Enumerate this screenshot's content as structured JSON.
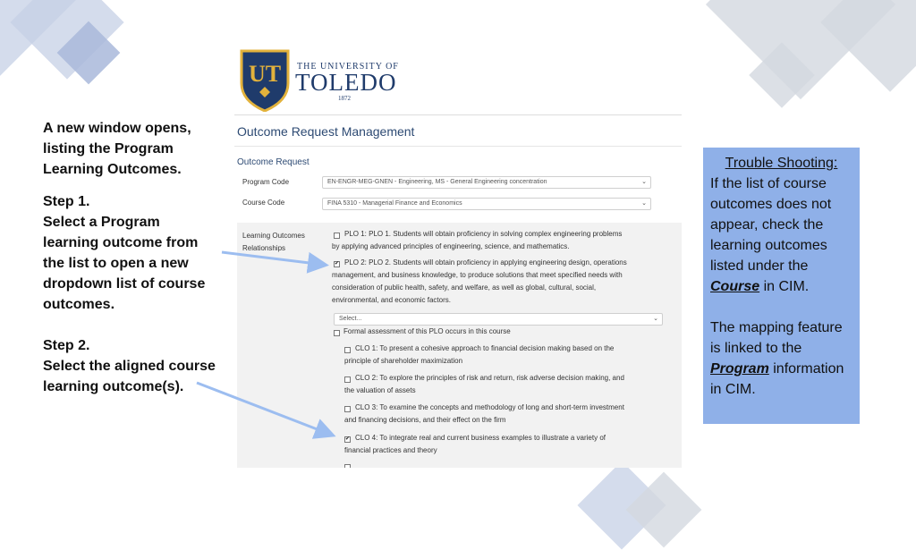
{
  "left": {
    "intro": [
      "A new window opens,",
      "listing the Program",
      "Learning Outcomes."
    ],
    "step1_title": "Step 1.",
    "step1_lines": [
      "Select a Program",
      "learning outcome from",
      "the list to open a new",
      "dropdown list of course",
      "outcomes."
    ],
    "step2_title": "Step 2.",
    "step2_lines": [
      "Select the aligned course",
      "learning outcome(s)."
    ]
  },
  "logo": {
    "monogram": "UT",
    "line1": "THE UNIVERSITY OF",
    "line2": "TOLEDO",
    "year": "1872"
  },
  "panel": {
    "title": "Outcome Request Management",
    "section": "Outcome Request",
    "program_code_label": "Program Code",
    "program_code_value": "EN-ENGR-MEG-GNEN - Engineering, MS - General Engineering concentration",
    "course_code_label": "Course Code",
    "course_code_value": "FINA 5310 - Managerial Finance and Economics",
    "lo_label_1": "Learning Outcomes",
    "lo_label_2": "Relationships",
    "plo1": [
      "PLO 1: PLO 1. Students will obtain proficiency in solving complex engineering problems",
      "by applying advanced principles of engineering, science, and mathematics."
    ],
    "plo2": [
      "PLO 2: PLO 2. Students will obtain proficiency in applying engineering design, operations",
      "management, and business knowledge, to produce solutions that meet specified needs with",
      "consideration of public health, safety, and welfare, as well as global, cultural, social,",
      "environmental, and economic factors."
    ],
    "select_placeholder": "Select...",
    "formal_assessment": "Formal assessment of this PLO occurs in this course",
    "clo1": [
      "CLO 1: To present a cohesive approach to financial decision making based on the",
      "principle of shareholder maximization"
    ],
    "clo2": [
      "CLO 2: To explore the principles of risk and return, risk adverse decision making, and",
      "the valuation of assets"
    ],
    "clo3": [
      "CLO 3: To examine the concepts and methodology of long and short-term investment",
      "and financing decisions, and their effect on the firm"
    ],
    "clo4": [
      "CLO 4: To integrate real and current business examples to illustrate a variety of",
      "financial practices and theory"
    ],
    "checked": {
      "plo1": false,
      "plo2": true,
      "formal": false,
      "clo1": false,
      "clo2": false,
      "clo3": false,
      "clo4": true
    }
  },
  "trouble": {
    "heading": "Trouble Shooting:",
    "p1_pre": "If the list of course outcomes does not appear, check the learning outcomes listed under the",
    "p1_em": "Course",
    "p1_post": "in CIM.",
    "p2_pre": "The mapping feature is linked to the",
    "p2_em": "Program",
    "p2_post": "information in CIM."
  },
  "colors": {
    "accent_blue": "#8fb0e8",
    "logo_navy": "#1f3b6b",
    "logo_gold": "#e2b23c",
    "arrow": "#9cbdf0"
  }
}
